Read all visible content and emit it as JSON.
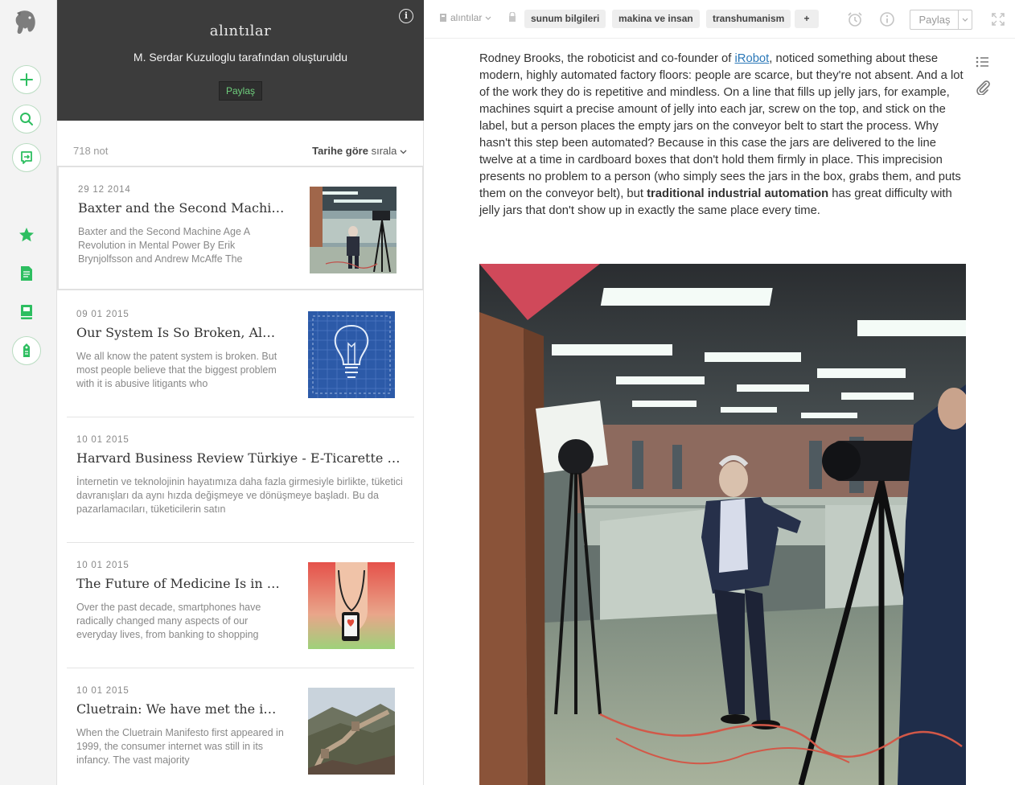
{
  "sidebar": {
    "logo": "elephant-logo",
    "actions": [
      {
        "name": "new-note-button",
        "icon": "plus-icon"
      },
      {
        "name": "search-button",
        "icon": "search-icon"
      },
      {
        "name": "work-chat-button",
        "icon": "chat-icon"
      }
    ],
    "nav": [
      {
        "name": "shortcuts-nav",
        "icon": "star-icon"
      },
      {
        "name": "notes-nav",
        "icon": "note-icon"
      },
      {
        "name": "notebooks-nav",
        "icon": "notebook-icon"
      },
      {
        "name": "tags-nav",
        "icon": "tag-icon"
      }
    ],
    "accent": "#2dbe60"
  },
  "notebook": {
    "title": "alıntılar",
    "subtitle": "M. Serdar Kuzuloglu tarafından oluşturuldu",
    "share_label": "Paylaş",
    "info_glyph": "i"
  },
  "note_list": {
    "count_label": "718 not",
    "sort_bold": "Tarihe göre",
    "sort_rest": "sırala",
    "notes": [
      {
        "date": "29 12 2014",
        "title": "Baxter and the Second Machine Age",
        "snippet": "Baxter and the Second Machine Age A Revolution in Mental Power By Erik Brynjolfsson and Andrew McAffe The",
        "thumb": "office-photo"
      },
      {
        "date": "09 01 2015",
        "title": "Our System Is So Broken, Almost",
        "snippet": "We all know the patent system is broken. But most people believe that the biggest problem with it is abusive litigants who",
        "thumb": "lightbulb-blueprint"
      },
      {
        "date": "10 01 2015",
        "title": "Harvard Business Review Türkiye - E-Ticarette Güven",
        "snippet": "İnternetin ve teknolojinin hayatımıza daha fazla girmesiyle birlikte, tüketici davranışları da aynı hızda değişmeye ve dönüşmeye başladı. Bu da pazarlamacıları, tüketicilerin satın",
        "thumb": ""
      },
      {
        "date": "10 01 2015",
        "title": "The Future of Medicine Is in Your Smartphone",
        "snippet": "Over the past decade, smartphones have radically changed many aspects of our everyday lives, from banking to shopping",
        "thumb": "stethoscope-phone"
      },
      {
        "date": "10 01 2015",
        "title": "Cluetrain: We have met the internet",
        "snippet": "When the Cluetrain Manifesto first appeared in 1999, the consumer internet was still in its infancy. The vast majority",
        "thumb": "great-wall"
      }
    ]
  },
  "toolbar": {
    "notebook_label": "alıntılar",
    "tags": [
      "sunum bilgileri",
      "makina ve insan",
      "transhumanism"
    ],
    "add_tag": "+",
    "share_label": "Paylaş"
  },
  "editor": {
    "para_before_link": "Rodney Brooks, the roboticist and co-founder of ",
    "link_text": "iRobot",
    "para_after_link": ", noticed something about these modern, highly automated factory floors: people are scarce, but they're not absent. And a lot of the work they do is repetitive and mindless. On a line that fills up jelly jars, for example, machines squirt a precise amount of jelly into each jar, screw on the top, and stick on the label, but a person places the empty jars on the conveyor belt to start the process. Why hasn't this step been automated? Because in this case the jars are delivered to the line twelve at a time in cardboard boxes that don't hold them firmly in place. This imprecision presents no problem to a person (who simply sees the jars in the box, grabs them, and puts them on the conveyor belt), but ",
    "bold_text": "traditional industrial automation",
    "para_end": " has great difficulty with jelly jars that don't show up in exactly the same place every time.",
    "photo": "office-film-shoot"
  }
}
